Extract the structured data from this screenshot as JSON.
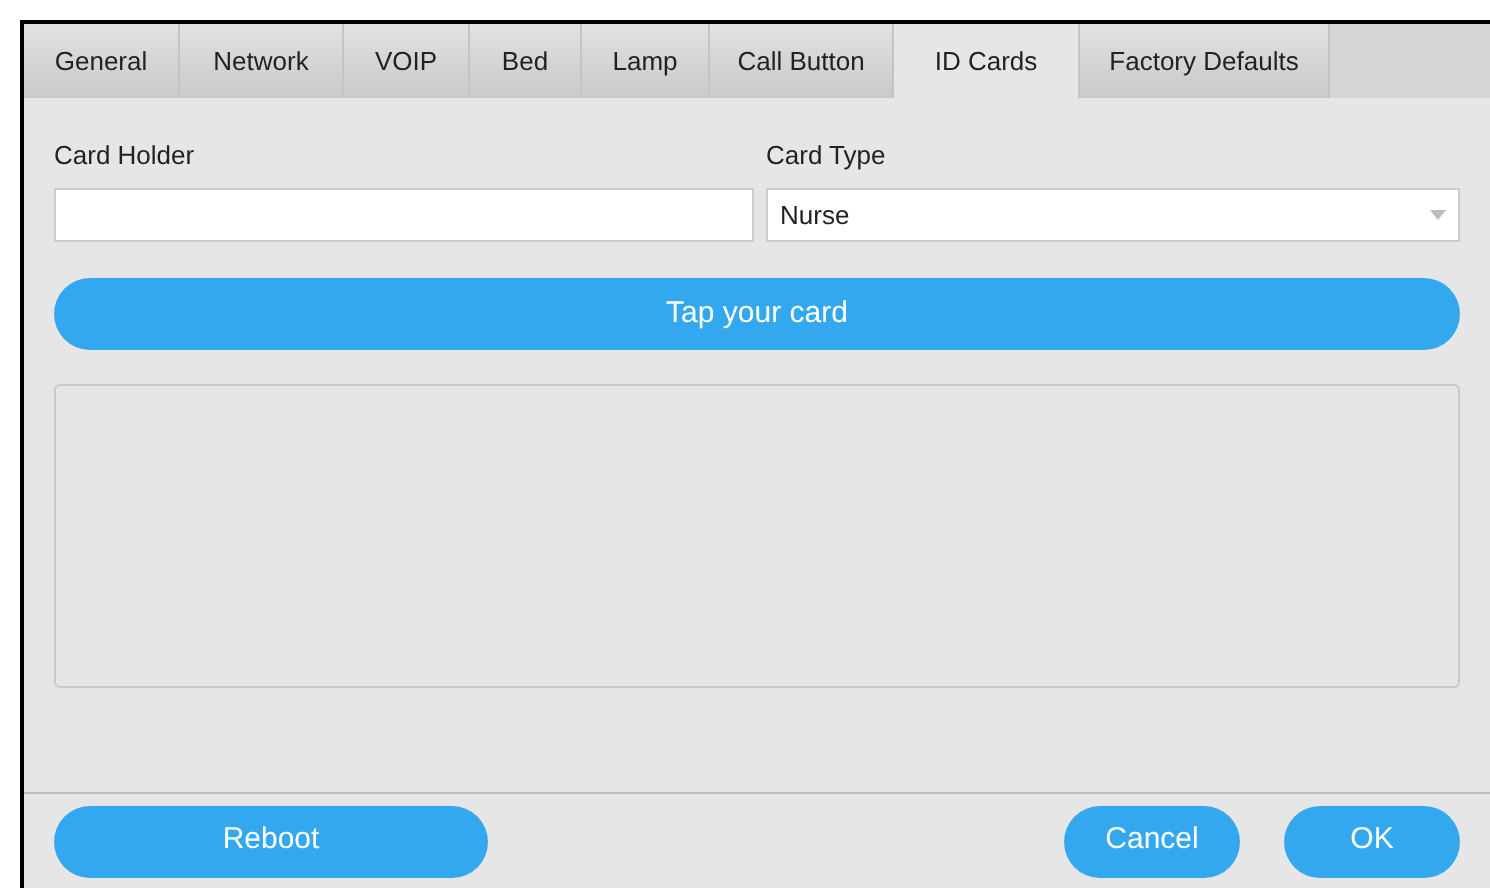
{
  "tabs": [
    {
      "label": "General",
      "selected": false
    },
    {
      "label": "Network",
      "selected": false
    },
    {
      "label": "VOIP",
      "selected": false
    },
    {
      "label": "Bed",
      "selected": false
    },
    {
      "label": "Lamp",
      "selected": false
    },
    {
      "label": "Call Button",
      "selected": false
    },
    {
      "label": "ID Cards",
      "selected": true
    },
    {
      "label": "Factory Defaults",
      "selected": false
    }
  ],
  "card_holder": {
    "label": "Card Holder"
  },
  "card_type": {
    "label": "Card Type",
    "value": "Nurse"
  },
  "tap_button": "Tap your card",
  "footer": {
    "reboot": "Reboot",
    "cancel": "Cancel",
    "ok": "OK"
  }
}
